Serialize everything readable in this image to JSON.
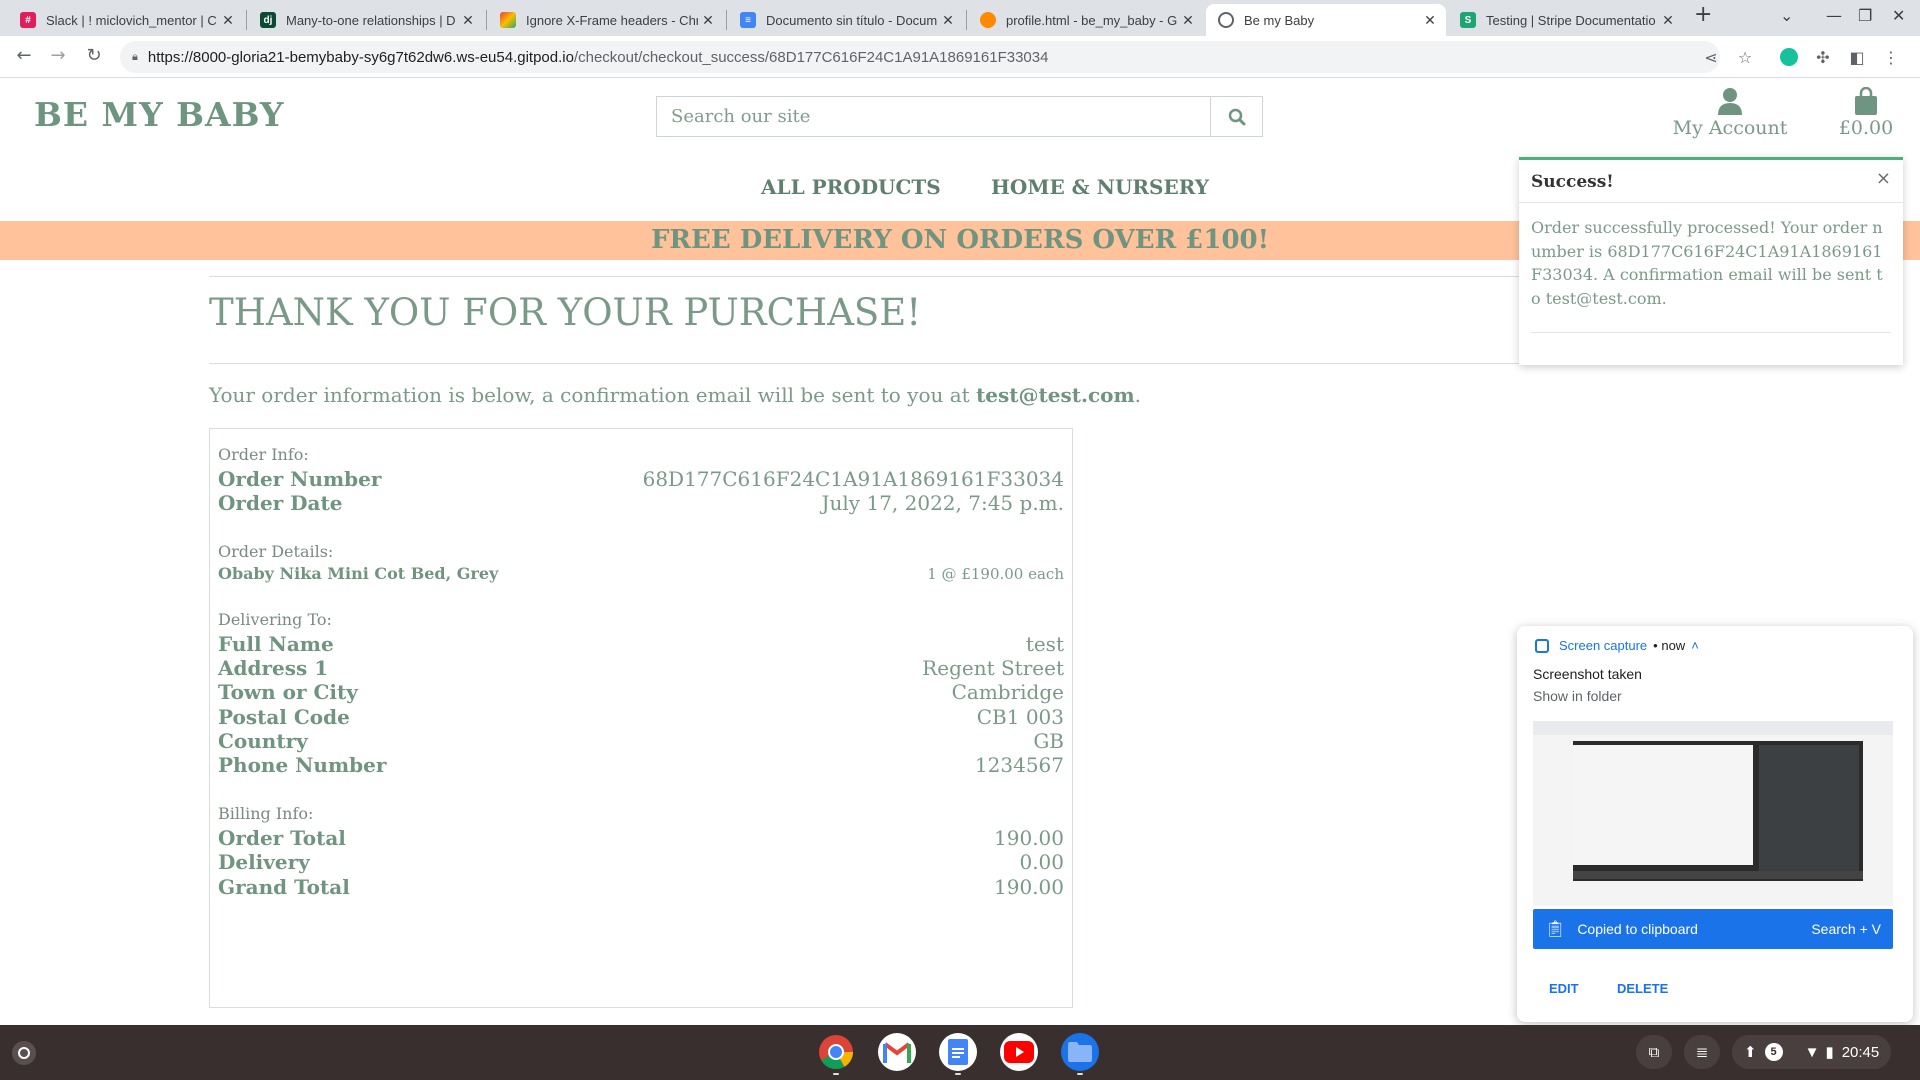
{
  "browser": {
    "tabs": [
      {
        "title": "Slack | ! miclovich_mentor | C",
        "favicon": "slack",
        "color": "#e01e5a"
      },
      {
        "title": "Many-to-one relationships | D",
        "favicon": "dj",
        "color": "#0c4b33"
      },
      {
        "title": "Ignore X-Frame headers - Chr",
        "favicon": "chrome-webstore",
        "color": "#fbbc04"
      },
      {
        "title": "Documento sin título - Docum",
        "favicon": "docs",
        "color": "#4285f4"
      },
      {
        "title": "profile.html - be_my_baby - G",
        "favicon": "gitpod",
        "color": "#ff8a00"
      },
      {
        "title": "Be my Baby",
        "favicon": "globe",
        "color": "#5f6368"
      },
      {
        "title": "Testing | Stripe Documentatio",
        "favicon": "S",
        "color": "#1ea672"
      }
    ],
    "url_host": "https://8000-gloria21-bemybaby-sy6g7t62dw6.ws-eu54.gitpod.io",
    "url_path": "/checkout/checkout_success/68D177C616F24C1A91A1869161F33034"
  },
  "site": {
    "logo": "BE MY BABY",
    "search_placeholder": "Search our site",
    "account_label": "My Account",
    "bag_total": "£0.00",
    "nav": [
      "ALL PRODUCTS",
      "HOME & NURSERY"
    ],
    "banner": "FREE DELIVERY ON ORDERS OVER £100!"
  },
  "checkout": {
    "heading": "THANK YOU FOR YOUR PURCHASE!",
    "info_text": "Your order information is below, a confirmation email will be sent to you at ",
    "email": "test@test.com",
    "info_end": ".",
    "order_info_label": "Order Info:",
    "order_number_label": "Order Number",
    "order_number": "68D177C616F24C1A91A1869161F33034",
    "order_date_label": "Order Date",
    "order_date": "July 17, 2022, 7:45 p.m.",
    "order_details_label": "Order Details:",
    "item_name": "Obaby Nika Mini Cot Bed, Grey",
    "item_qty": "1 @ £190.00 each",
    "delivering_label": "Delivering To:",
    "delivery": [
      {
        "label": "Full Name",
        "value": "test"
      },
      {
        "label": "Address 1",
        "value": "Regent Street"
      },
      {
        "label": "Town or City",
        "value": "Cambridge"
      },
      {
        "label": "Postal Code",
        "value": "CB1 003"
      },
      {
        "label": "Country",
        "value": "GB"
      },
      {
        "label": "Phone Number",
        "value": "1234567"
      }
    ],
    "billing_label": "Billing Info:",
    "billing": [
      {
        "label": "Order Total",
        "value": "190.00"
      },
      {
        "label": "Delivery",
        "value": "0.00"
      },
      {
        "label": "Grand Total",
        "value": "190.00"
      }
    ]
  },
  "toast": {
    "title": "Success!",
    "close": "×",
    "body": "Order successfully processed! Your order number is 68D177C616F24C1A91A1869161F33034. A confirmation email will be sent to test@test.com."
  },
  "notification": {
    "source": "Screen capture",
    "time": "• now",
    "title": "Screenshot taken",
    "subtitle": "Show in folder",
    "clipboard": "Copied to clipboard",
    "search_shortcut": "Search + V",
    "edit": "EDIT",
    "delete": "DELETE"
  },
  "shelf": {
    "apps": [
      "chrome",
      "gmail",
      "docs",
      "youtube",
      "files"
    ],
    "notif_count": "5",
    "time": "20:45"
  }
}
